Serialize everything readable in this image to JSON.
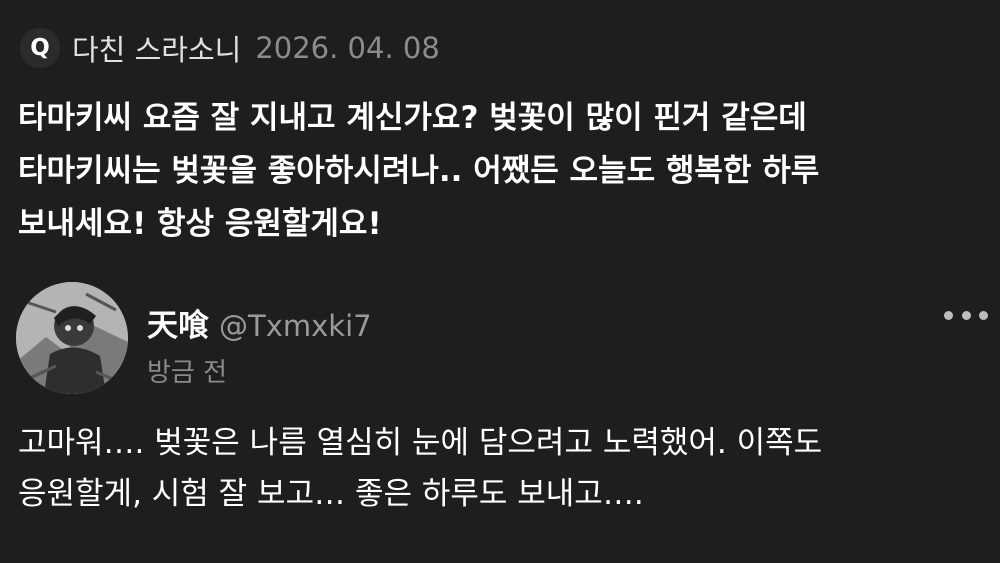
{
  "question": {
    "badge": "Q",
    "asker": "다친 스라소니",
    "date": "2026. 04. 08",
    "lines": [
      "타마키씨 요즘 잘 지내고 계신가요? 벚꽃이 많이 핀거 같은데",
      "타마키씨는 벚꽃을 좋아하시려나.. 어쨌든 오늘도 행복한 하루",
      "보내세요! 항상 응원할게요!"
    ]
  },
  "answer": {
    "display_name": "天喰",
    "handle": "@Txmxki7",
    "time_ago": "방금 전",
    "more_icon": "more-horizontal-icon",
    "lines": [
      "고마워…. 벚꽃은 나름 열심히 눈에 담으려고 노력했어. 이쪽도",
      "응원할게, 시험 잘 보고… 좋은 하루도 보내고…."
    ]
  }
}
